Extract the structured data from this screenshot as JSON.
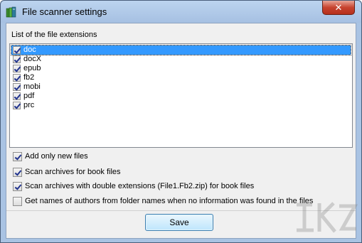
{
  "window": {
    "title": "File scanner settings",
    "close_symbol": "✕"
  },
  "extensions": {
    "label": "List of the file extensions",
    "items": [
      {
        "name": "doc",
        "checked": true,
        "selected": true
      },
      {
        "name": "docX",
        "checked": true,
        "selected": false
      },
      {
        "name": "epub",
        "checked": true,
        "selected": false
      },
      {
        "name": "fb2",
        "checked": true,
        "selected": false
      },
      {
        "name": "mobi",
        "checked": true,
        "selected": false
      },
      {
        "name": "pdf",
        "checked": true,
        "selected": false
      },
      {
        "name": "prc",
        "checked": true,
        "selected": false
      }
    ]
  },
  "options": [
    {
      "label": "Add only new files",
      "checked": true
    },
    {
      "label": "Scan archives for book files",
      "checked": true
    },
    {
      "label": "Scan archives with double extensions (File1.Fb2.zip) for book files",
      "checked": true
    },
    {
      "label": "Get names of authors from folder names when no information was found in the files",
      "checked": false
    }
  ],
  "buttons": {
    "save": "Save"
  },
  "icons": {
    "app": "books-icon",
    "close": "close-icon"
  },
  "colors": {
    "selection": "#3399ff",
    "close_button": "#c7432f",
    "titlebar": "#b0c9e8"
  }
}
